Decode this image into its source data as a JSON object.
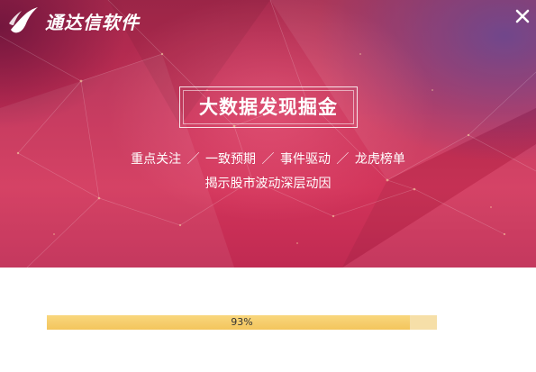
{
  "app": {
    "name": "通达信软件",
    "logo_icon": "tdx-swoosh-logo-icon",
    "close_icon": "close-icon"
  },
  "banner": {
    "headline": "大数据发现掘金",
    "tagline_items": [
      "重点关注",
      "一致预期",
      "事件驱动",
      "龙虎榜单"
    ],
    "tagline_separator": "／",
    "tagline_line2": "揭示股市波动深层动因"
  },
  "progress": {
    "value": 0.93,
    "label": "93%"
  },
  "colors": {
    "banner_base": "#c42e55",
    "banner_dark": "#a5284c",
    "banner_purple": "#5a3c8c",
    "progress_fill": "#f3c55c",
    "progress_track": "#f6dfa8",
    "text_light": "#ffffff"
  }
}
